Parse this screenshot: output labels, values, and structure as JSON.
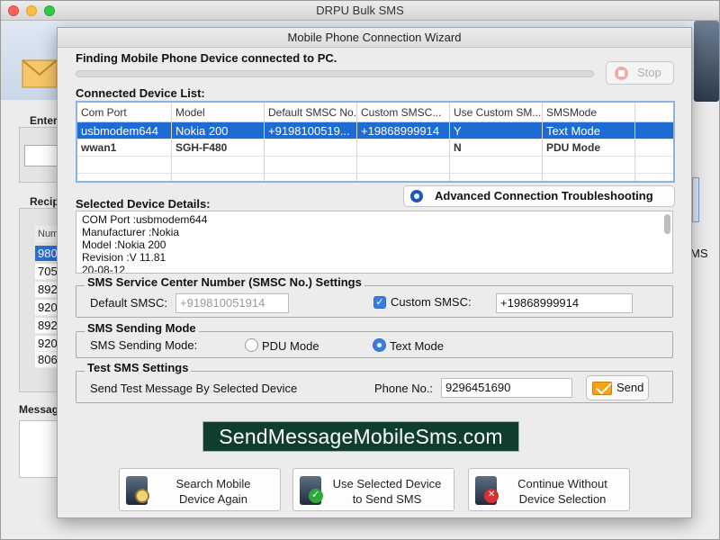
{
  "main": {
    "title": "DRPU Bulk SMS",
    "enter_label": "Enter",
    "recipients_label": "Recip",
    "num_header": "Num",
    "numbers": [
      "980",
      "705",
      "892",
      "920",
      "892",
      "920",
      "806"
    ],
    "message_label": "Messag",
    "right_text": "MS"
  },
  "wizard": {
    "title": "Mobile Phone Connection Wizard",
    "status": "Finding Mobile Phone Device connected to PC.",
    "stop_label": "Stop",
    "connected_list_label": "Connected Device List:",
    "columns": [
      "Com Port",
      "Model",
      "Default SMSC No.",
      "Custom SMSC...",
      "Use Custom SM...",
      "SMSMode"
    ],
    "devices": [
      [
        "usbmodem644",
        "Nokia 200",
        "+9198100519...",
        "+19868999914",
        "Y",
        "Text Mode"
      ],
      [
        "wwan1",
        "SGH-F480",
        "",
        "",
        "N",
        "PDU Mode"
      ]
    ],
    "advanced_button": "Advanced Connection Troubleshooting",
    "selected_details_label": "Selected Device Details:",
    "details": [
      "COM Port :usbmodem644",
      "Manufacturer :Nokia",
      "Model :Nokia 200",
      "Revision :V 11.81",
      "20-08-12"
    ],
    "smsc": {
      "title": "SMS Service Center Number (SMSC No.) Settings",
      "default_label": "Default SMSC:",
      "default_value": "+919810051914",
      "custom_label": "Custom SMSC:",
      "custom_value": "+19868999914",
      "custom_checked": true
    },
    "mode": {
      "title": "SMS Sending Mode",
      "label": "SMS Sending Mode:",
      "pdu_label": "PDU Mode",
      "text_label": "Text Mode",
      "selected": "Text Mode"
    },
    "test": {
      "title": "Test SMS Settings",
      "label": "Send Test Message By Selected Device",
      "phone_label": "Phone No.:",
      "phone_value": "9296451690",
      "send_label": "Send"
    },
    "watermark": "SendMessageMobileSms.com",
    "actions": {
      "search_line1": "Search Mobile",
      "search_line2": "Device Again",
      "use_line1": "Use Selected Device",
      "use_line2": "to Send SMS",
      "continue_line1": "Continue Without",
      "continue_line2": "Device Selection"
    }
  }
}
